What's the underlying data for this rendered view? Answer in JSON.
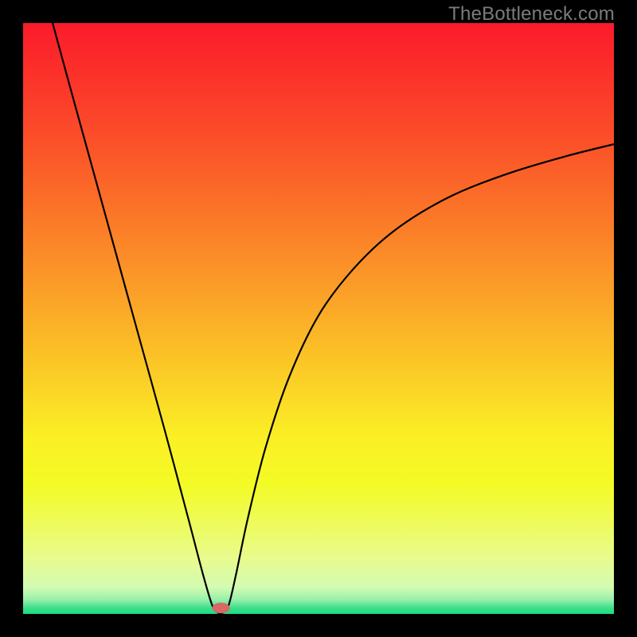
{
  "watermark": "TheBottleneck.com",
  "chart_data": {
    "type": "line",
    "title": "",
    "xlabel": "",
    "ylabel": "",
    "xlim": [
      0,
      100
    ],
    "ylim": [
      0,
      100
    ],
    "grid": false,
    "legend": false,
    "gradient_stops": [
      {
        "offset": 0.0,
        "color": "#fb1b2b"
      },
      {
        "offset": 0.1,
        "color": "#fb352a"
      },
      {
        "offset": 0.2,
        "color": "#fb5029"
      },
      {
        "offset": 0.3,
        "color": "#fb6f28"
      },
      {
        "offset": 0.4,
        "color": "#fb8e28"
      },
      {
        "offset": 0.5,
        "color": "#fbae27"
      },
      {
        "offset": 0.6,
        "color": "#fbce26"
      },
      {
        "offset": 0.7,
        "color": "#fbef25"
      },
      {
        "offset": 0.78,
        "color": "#f3fb25"
      },
      {
        "offset": 0.84,
        "color": "#eefb55"
      },
      {
        "offset": 0.905,
        "color": "#e8fb8d"
      },
      {
        "offset": 0.955,
        "color": "#d3fbb2"
      },
      {
        "offset": 0.975,
        "color": "#9bf1ab"
      },
      {
        "offset": 0.99,
        "color": "#3ddf8c"
      },
      {
        "offset": 1.0,
        "color": "#1bdc82"
      }
    ],
    "series": [
      {
        "name": "bottleneck-curve",
        "color": "#000000",
        "x": [
          5.0,
          8.0,
          12.0,
          16.0,
          20.0,
          24.0,
          28.0,
          30.5,
          32.0,
          33.0,
          33.8,
          34.8,
          36.0,
          38.0,
          41.0,
          45.0,
          50.0,
          56.0,
          63.0,
          72.0,
          82.0,
          92.0,
          100.0
        ],
        "values": [
          100.0,
          89.0,
          74.5,
          60.0,
          45.5,
          31.0,
          16.0,
          6.5,
          1.5,
          0.2,
          0.2,
          1.5,
          6.5,
          16.0,
          28.0,
          40.0,
          50.5,
          58.5,
          65.0,
          70.5,
          74.5,
          77.5,
          79.5
        ]
      }
    ],
    "marker": {
      "name": "optimum-marker",
      "x": 33.5,
      "y": 1.0,
      "color": "#d96765",
      "rx": 1.5,
      "ry": 0.9
    }
  }
}
